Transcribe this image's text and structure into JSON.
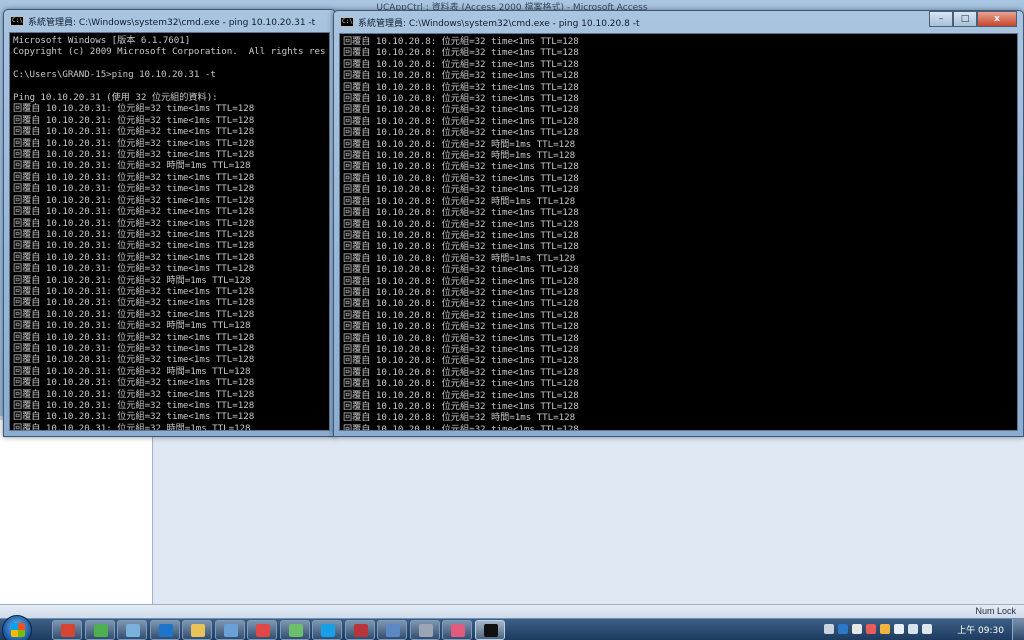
{
  "background_app": {
    "title": "UCAppCtrl : 資料表 (Access 2000 檔案格式) - Microsoft Access"
  },
  "status_bar": {
    "num_lock": "Num Lock"
  },
  "left_window": {
    "title": "系統管理員: C:\\Windows\\system32\\cmd.exe - ping  10.10.20.31 -t",
    "console_lines": [
      "Microsoft Windows [版本 6.1.7601]",
      "Copyright (c) 2009 Microsoft Corporation.  All rights res",
      "",
      "C:\\Users\\GRAND-15>ping 10.10.20.31 -t",
      "",
      "Ping 10.10.20.31 (使用 32 位元組的資料):",
      "回覆自 10.10.20.31: 位元組=32 time<1ms TTL=128",
      "回覆自 10.10.20.31: 位元組=32 time<1ms TTL=128",
      "回覆自 10.10.20.31: 位元組=32 time<1ms TTL=128",
      "回覆自 10.10.20.31: 位元組=32 time<1ms TTL=128",
      "回覆自 10.10.20.31: 位元組=32 time<1ms TTL=128",
      "回覆自 10.10.20.31: 位元組=32 時間=1ms TTL=128",
      "回覆自 10.10.20.31: 位元組=32 time<1ms TTL=128",
      "回覆自 10.10.20.31: 位元組=32 time<1ms TTL=128",
      "回覆自 10.10.20.31: 位元組=32 time<1ms TTL=128",
      "回覆自 10.10.20.31: 位元組=32 time<1ms TTL=128",
      "回覆自 10.10.20.31: 位元組=32 time<1ms TTL=128",
      "回覆自 10.10.20.31: 位元組=32 time<1ms TTL=128",
      "回覆自 10.10.20.31: 位元組=32 time<1ms TTL=128",
      "回覆自 10.10.20.31: 位元組=32 time<1ms TTL=128",
      "回覆自 10.10.20.31: 位元組=32 time<1ms TTL=128",
      "回覆自 10.10.20.31: 位元組=32 時間=1ms TTL=128",
      "回覆自 10.10.20.31: 位元組=32 time<1ms TTL=128",
      "回覆自 10.10.20.31: 位元組=32 time<1ms TTL=128",
      "回覆自 10.10.20.31: 位元組=32 time<1ms TTL=128",
      "回覆自 10.10.20.31: 位元組=32 時間=1ms TTL=128",
      "回覆自 10.10.20.31: 位元組=32 time<1ms TTL=128",
      "回覆自 10.10.20.31: 位元組=32 time<1ms TTL=128",
      "回覆自 10.10.20.31: 位元組=32 time<1ms TTL=128",
      "回覆自 10.10.20.31: 位元組=32 時間=1ms TTL=128",
      "回覆自 10.10.20.31: 位元組=32 time<1ms TTL=128",
      "回覆自 10.10.20.31: 位元組=32 time<1ms TTL=128",
      "回覆自 10.10.20.31: 位元組=32 time<1ms TTL=128",
      "回覆自 10.10.20.31: 位元組=32 time<1ms TTL=128",
      "回覆自 10.10.20.31: 位元組=32 時間=1ms TTL=128"
    ]
  },
  "right_window": {
    "title": "系統管理員: C:\\Windows\\system32\\cmd.exe - ping  10.10.20.8 -t",
    "controls": {
      "minimize": "–",
      "maximize": "□",
      "close": "x"
    },
    "console_lines": [
      "回覆自 10.10.20.8: 位元組=32 time<1ms TTL=128",
      "回覆自 10.10.20.8: 位元組=32 time<1ms TTL=128",
      "回覆自 10.10.20.8: 位元組=32 time<1ms TTL=128",
      "回覆自 10.10.20.8: 位元組=32 time<1ms TTL=128",
      "回覆自 10.10.20.8: 位元組=32 time<1ms TTL=128",
      "回覆自 10.10.20.8: 位元組=32 time<1ms TTL=128",
      "回覆自 10.10.20.8: 位元組=32 time<1ms TTL=128",
      "回覆自 10.10.20.8: 位元組=32 time<1ms TTL=128",
      "回覆自 10.10.20.8: 位元組=32 time<1ms TTL=128",
      "回覆自 10.10.20.8: 位元組=32 時間=1ms TTL=128",
      "回覆自 10.10.20.8: 位元組=32 時間=1ms TTL=128",
      "回覆自 10.10.20.8: 位元組=32 time<1ms TTL=128",
      "回覆自 10.10.20.8: 位元組=32 time<1ms TTL=128",
      "回覆自 10.10.20.8: 位元組=32 time<1ms TTL=128",
      "回覆自 10.10.20.8: 位元組=32 時間=1ms TTL=128",
      "回覆自 10.10.20.8: 位元組=32 time<1ms TTL=128",
      "回覆自 10.10.20.8: 位元組=32 time<1ms TTL=128",
      "回覆自 10.10.20.8: 位元組=32 time<1ms TTL=128",
      "回覆自 10.10.20.8: 位元組=32 time<1ms TTL=128",
      "回覆自 10.10.20.8: 位元組=32 時間=1ms TTL=128",
      "回覆自 10.10.20.8: 位元組=32 time<1ms TTL=128",
      "回覆自 10.10.20.8: 位元組=32 time<1ms TTL=128",
      "回覆自 10.10.20.8: 位元組=32 time<1ms TTL=128",
      "回覆自 10.10.20.8: 位元組=32 time<1ms TTL=128",
      "回覆自 10.10.20.8: 位元組=32 time<1ms TTL=128",
      "回覆自 10.10.20.8: 位元組=32 time<1ms TTL=128",
      "回覆自 10.10.20.8: 位元組=32 time<1ms TTL=128",
      "回覆自 10.10.20.8: 位元組=32 time<1ms TTL=128",
      "回覆自 10.10.20.8: 位元組=32 time<1ms TTL=128",
      "回覆自 10.10.20.8: 位元組=32 time<1ms TTL=128",
      "回覆自 10.10.20.8: 位元組=32 time<1ms TTL=128",
      "回覆自 10.10.20.8: 位元組=32 time<1ms TTL=128",
      "回覆自 10.10.20.8: 位元組=32 time<1ms TTL=128",
      "回覆自 10.10.20.8: 位元組=32 時間=1ms TTL=128",
      "回覆自 10.10.20.8: 位元組=32 time<1ms TTL=128",
      "回覆自 10.10.20.8: 位元組=32 time<1ms TTL=128",
      "回覆自 10.10.20.8: 位元組=32 time<1ms TTL=128"
    ]
  },
  "taskbar": {
    "items": [
      {
        "icon": "chrome-icon",
        "color": "#d64531"
      },
      {
        "icon": "vine-icon",
        "color": "#4caf50"
      },
      {
        "icon": "monitor-icon",
        "color": "#7ab0dc"
      },
      {
        "icon": "ie-icon",
        "color": "#1d75c9"
      },
      {
        "icon": "folder-icon",
        "color": "#e8c35a"
      },
      {
        "icon": "network-icon",
        "color": "#6aa2d8"
      },
      {
        "icon": "paint-icon",
        "color": "#e04848"
      },
      {
        "icon": "notepad-icon",
        "color": "#6bbf6a"
      },
      {
        "icon": "skype-icon",
        "color": "#18a0e6"
      },
      {
        "icon": "access-icon",
        "color": "#b8353c"
      },
      {
        "icon": "remote-desktop-icon",
        "color": "#5c88c4"
      },
      {
        "icon": "printer-icon",
        "color": "#9aa6b3"
      },
      {
        "icon": "tool-icon",
        "color": "#e05b7c"
      },
      {
        "icon": "cmd-icon",
        "color": "#111111"
      }
    ],
    "clock": "上午 09:30"
  }
}
